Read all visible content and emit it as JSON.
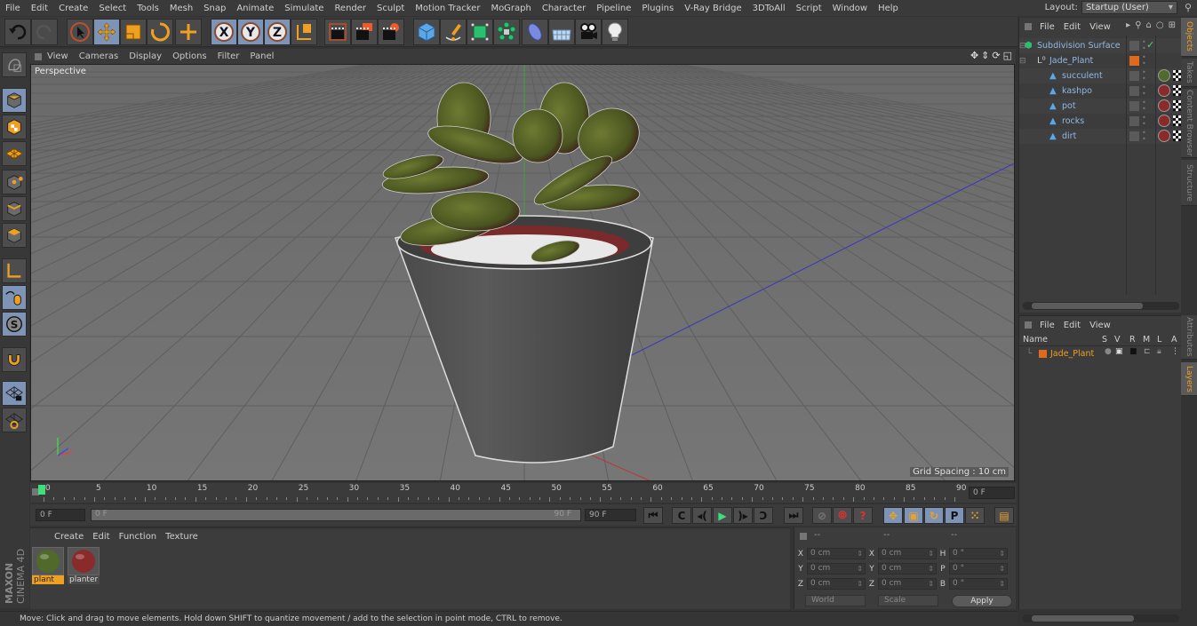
{
  "app": {
    "name": "Cinema 4D",
    "brand_lines": [
      "MAXON",
      "CINEMA 4D"
    ]
  },
  "menubar": {
    "items": [
      "File",
      "Edit",
      "Create",
      "Select",
      "Tools",
      "Mesh",
      "Snap",
      "Animate",
      "Simulate",
      "Render",
      "Sculpt",
      "Motion Tracker",
      "MoGraph",
      "Character",
      "Pipeline",
      "Plugins",
      "V-Ray Bridge",
      "3DToAll",
      "Script",
      "Window",
      "Help"
    ],
    "layout_label": "Layout:",
    "layout_value": "Startup (User)"
  },
  "toolbar": {
    "tools": [
      {
        "icon": "undo-icon"
      },
      {
        "icon": "redo-icon"
      },
      {
        "icon": "live-selection-icon"
      },
      {
        "icon": "move-icon",
        "active": true
      },
      {
        "icon": "scale-icon"
      },
      {
        "icon": "rotate-icon"
      },
      {
        "icon": "recent-tool-icon"
      },
      {
        "icon": "x-axis-lock-icon",
        "label": "X",
        "active": true
      },
      {
        "icon": "y-axis-lock-icon",
        "label": "Y",
        "active": true
      },
      {
        "icon": "z-axis-lock-icon",
        "label": "Z",
        "active": true
      },
      {
        "icon": "coordinate-system-icon"
      },
      {
        "icon": "render-view-icon"
      },
      {
        "icon": "render-picture-viewer-icon"
      },
      {
        "icon": "render-settings-icon"
      },
      {
        "icon": "cube-primitive-icon"
      },
      {
        "icon": "pen-spline-icon"
      },
      {
        "icon": "subdivision-generator-icon"
      },
      {
        "icon": "mograph-cloner-icon"
      },
      {
        "icon": "deformer-icon"
      },
      {
        "icon": "floor-scene-icon"
      },
      {
        "icon": "camera-icon"
      },
      {
        "icon": "light-icon"
      }
    ]
  },
  "left_tools": [
    {
      "icon": "make-editable-icon"
    },
    {
      "icon": "model-mode-icon",
      "active": true
    },
    {
      "icon": "texture-mode-icon"
    },
    {
      "icon": "workplane-mode-icon"
    },
    {
      "icon": "points-mode-icon"
    },
    {
      "icon": "edges-mode-icon"
    },
    {
      "icon": "polygons-mode-icon"
    },
    {
      "icon": "enable-axis-icon"
    },
    {
      "icon": "tweak-mode-icon",
      "active": true
    },
    {
      "icon": "solo-mode-icon",
      "active": true
    },
    {
      "icon": "snap-magnet-icon"
    },
    {
      "icon": "workplane-lock-icon",
      "active": true
    },
    {
      "icon": "planar-workplane-icon"
    }
  ],
  "viewport": {
    "menu": [
      "View",
      "Cameras",
      "Display",
      "Options",
      "Filter",
      "Panel"
    ],
    "label": "Perspective",
    "grid_spacing": "Grid Spacing : 10 cm",
    "nav_icons": [
      "pan-icon",
      "dolly-icon",
      "orbit-icon",
      "maximize-icon"
    ]
  },
  "timeline": {
    "ticks": [
      "0",
      "5",
      "10",
      "15",
      "20",
      "25",
      "30",
      "35",
      "40",
      "45",
      "50",
      "55",
      "60",
      "65",
      "70",
      "75",
      "80",
      "85",
      "90"
    ],
    "current_frame": "0 F",
    "start_field": "0 F",
    "range_start": "0 F",
    "range_end": "90 F",
    "end_field": "90 F",
    "playhead_fraction": 0.0
  },
  "playback": {
    "buttons": [
      "go-to-start-icon",
      "previous-key-icon",
      "previous-frame-icon",
      "play-icon",
      "next-frame-icon",
      "next-key-icon",
      "go-to-end-icon"
    ],
    "record_buttons": [
      "record-active-icon",
      "autokey-icon",
      "keyframe-selection-icon"
    ],
    "key_buttons": [
      "key-position-icon",
      "key-scale-icon",
      "key-rotation-icon",
      "key-parameter-icon",
      "key-pla-icon",
      "timeline-window-icon"
    ]
  },
  "materials": {
    "menu": [
      "Create",
      "Edit",
      "Function",
      "Texture"
    ],
    "items": [
      {
        "name": "plant",
        "selected": true,
        "color": "#4f6a2a"
      },
      {
        "name": "planter",
        "selected": false,
        "color": "#8a2a2a"
      }
    ]
  },
  "coordinates": {
    "headers": [
      "--",
      "--",
      "--"
    ],
    "rows": [
      {
        "a": "X",
        "v1": "0 cm",
        "b": "X",
        "v2": "0 cm",
        "c": "H",
        "v3": "0 °"
      },
      {
        "a": "Y",
        "v1": "0 cm",
        "b": "Y",
        "v2": "0 cm",
        "c": "P",
        "v3": "0 °"
      },
      {
        "a": "Z",
        "v1": "0 cm",
        "b": "Z",
        "v2": "0 cm",
        "c": "B",
        "v3": "0 °"
      }
    ],
    "mode1": "World",
    "mode2": "Scale",
    "apply": "Apply"
  },
  "status": "Move: Click and drag to move elements. Hold down SHIFT to quantize movement / add to the selection in point mode, CTRL to remove.",
  "objects": {
    "menu": [
      "File",
      "Edit",
      "View"
    ],
    "items": [
      {
        "name": "Subdivision Surface",
        "level": 0,
        "icon": "subdivision-surface-icon",
        "check": true
      },
      {
        "name": "Jade_Plant",
        "level": 1,
        "icon": "null-object-icon",
        "layer_color": "#e0691e"
      },
      {
        "name": "succulent",
        "level": 2,
        "icon": "polygon-object-icon",
        "material": "plant"
      },
      {
        "name": "kashpo",
        "level": 2,
        "icon": "polygon-object-icon",
        "material": "planter"
      },
      {
        "name": "pot",
        "level": 2,
        "icon": "polygon-object-icon",
        "material": "planter"
      },
      {
        "name": "rocks",
        "level": 2,
        "icon": "polygon-object-icon",
        "material": "planter"
      },
      {
        "name": "dirt",
        "level": 2,
        "icon": "polygon-object-icon",
        "material": "planter"
      }
    ]
  },
  "side_tabs_top": [
    {
      "label": "Objects",
      "active": true
    },
    {
      "label": "Takes"
    },
    {
      "label": "Content Browser"
    },
    {
      "label": "Structure"
    }
  ],
  "side_tabs_bottom": [
    {
      "label": "Attributes"
    },
    {
      "label": "Layers",
      "active": true
    }
  ],
  "layers": {
    "menu": [
      "File",
      "Edit",
      "View"
    ],
    "columns": [
      "Name",
      "S",
      "V",
      "R",
      "M",
      "L",
      "A"
    ],
    "items": [
      {
        "name": "Jade_Plant",
        "color": "#e0691e"
      }
    ]
  }
}
